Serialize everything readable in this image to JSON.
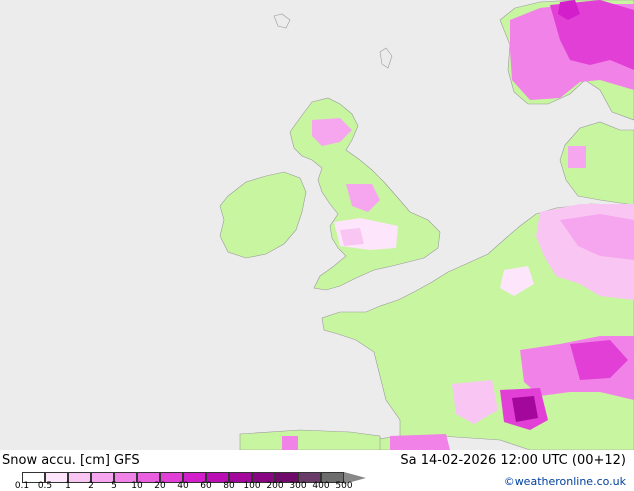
{
  "title": "Snow accu. [cm] GFS",
  "valid_time": "Sa 14-02-2026 12:00 UTC (00+12)",
  "credit": "©weatheronline.co.uk",
  "colors": {
    "sea": "#ececec",
    "land": "#c8f5a0",
    "coast": "#9a9a9a"
  },
  "legend": {
    "labels": [
      "0.1",
      "0.5",
      "1",
      "2",
      "5",
      "10",
      "20",
      "40",
      "60",
      "80",
      "100",
      "200",
      "300",
      "400",
      "500"
    ],
    "colors": [
      "#ffffff",
      "#fde6fb",
      "#f9c6f4",
      "#f5a6ee",
      "#f183e8",
      "#ea5fe0",
      "#e23fd7",
      "#d21fcb",
      "#bb0fb5",
      "#a3079c",
      "#880682",
      "#6f0a6a",
      "#6a3a68",
      "#6d6d6d"
    ],
    "arrow_color": "#888888"
  }
}
